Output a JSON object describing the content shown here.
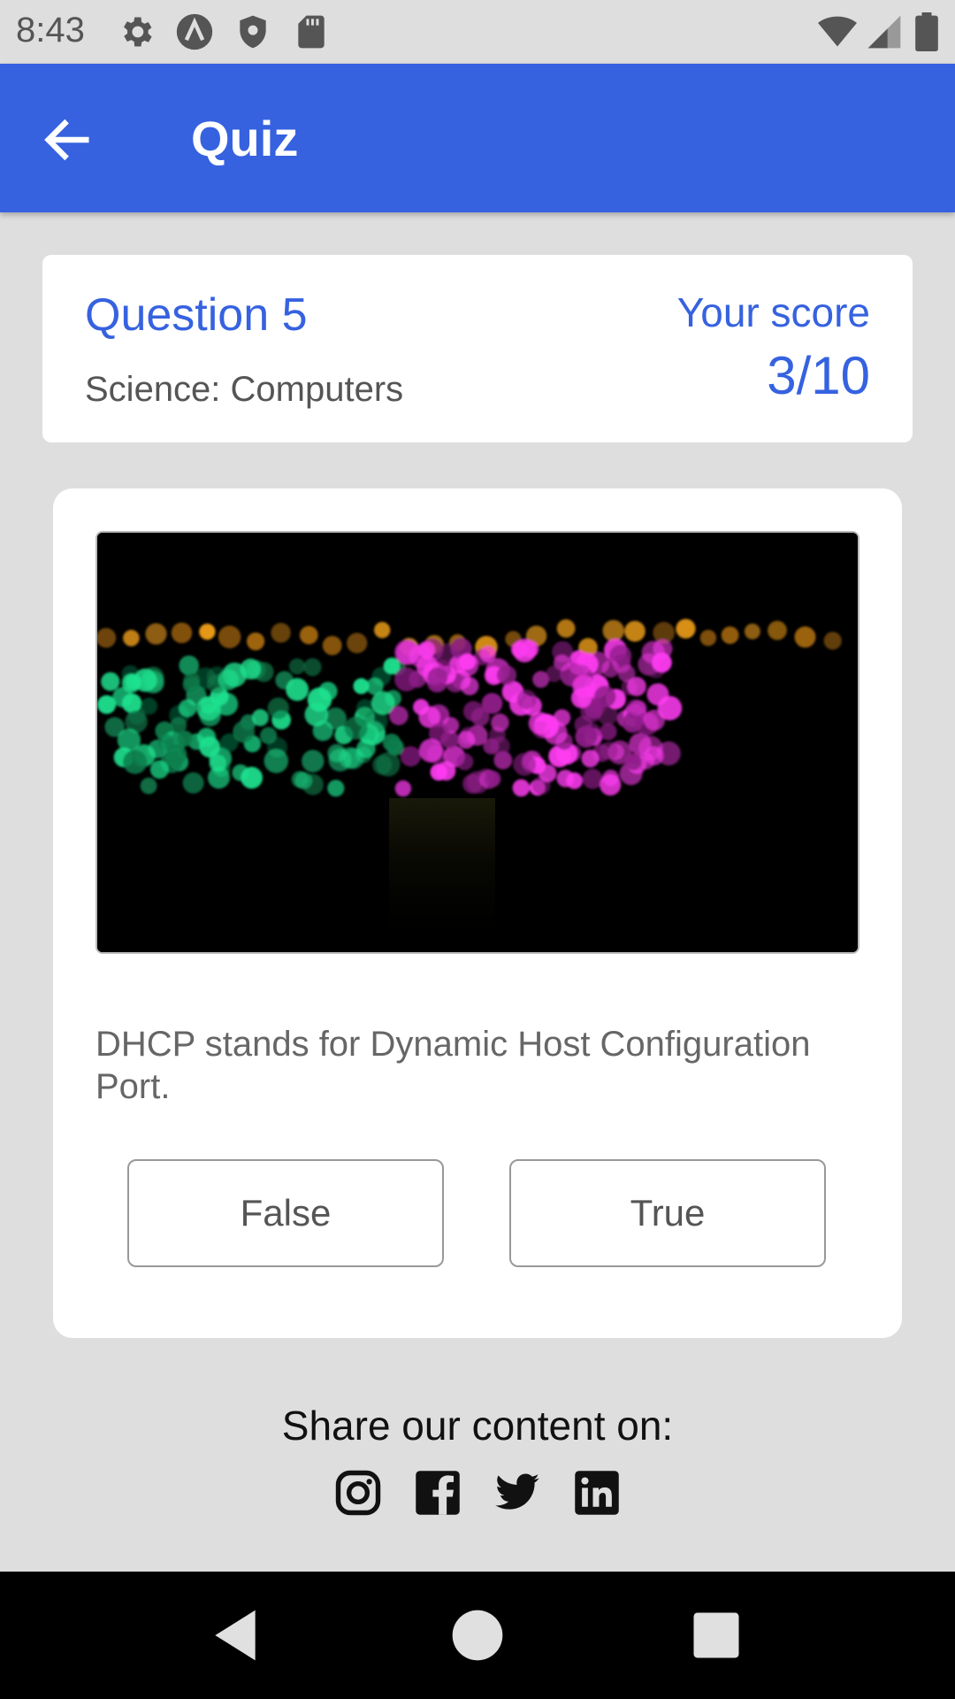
{
  "status_bar": {
    "time": "8:43",
    "icons": [
      "settings-icon",
      "app-logo-icon",
      "shield-icon",
      "sd-card-icon",
      "wifi-icon",
      "signal-icon",
      "battery-icon"
    ]
  },
  "app_bar": {
    "title": "Quiz",
    "color": "#3662e0",
    "back_icon": "arrow-left-icon"
  },
  "question_header": {
    "number_label": "Question 5",
    "category": "Science: Computers",
    "score_label": "Your score",
    "score_value": "3/10"
  },
  "question": {
    "image": "bokeh-lights-photo",
    "text": "DHCP stands for Dynamic Host Configuration Port.",
    "answers": [
      {
        "label": "False"
      },
      {
        "label": "True"
      }
    ]
  },
  "share": {
    "label": "Share our content on:",
    "networks": [
      "instagram-icon",
      "facebook-icon",
      "twitter-icon",
      "linkedin-icon"
    ]
  },
  "nav_bar": {
    "buttons": [
      "back-triangle-icon",
      "home-circle-icon",
      "recents-square-icon"
    ]
  }
}
